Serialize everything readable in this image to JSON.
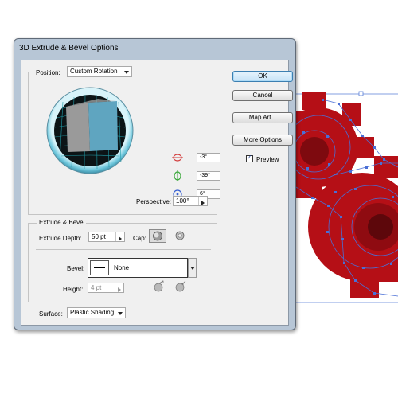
{
  "dialog": {
    "title": "3D Extrude & Bevel Options",
    "position": {
      "label": "Position:",
      "value": "Custom Rotation"
    },
    "rotation": {
      "x": "-3°",
      "y": "-39°",
      "z": "6°"
    },
    "perspective": {
      "label": "Perspective:",
      "value": "100°"
    },
    "extrude_bevel": {
      "section_title": "Extrude & Bevel",
      "depth_label": "Extrude Depth:",
      "depth_value": "50 pt",
      "cap_label": "Cap:",
      "bevel_label": "Bevel:",
      "bevel_value": "None",
      "height_label": "Height:",
      "height_value": "4 pt"
    },
    "surface": {
      "label": "Surface:",
      "value": "Plastic Shading"
    },
    "buttons": {
      "ok": "OK",
      "cancel": "Cancel",
      "map_art": "Map Art...",
      "more_options": "More Options"
    },
    "preview": {
      "label": "Preview",
      "checked": true
    }
  },
  "colors": {
    "gear": "#b50f16",
    "path": "#4a6fd6",
    "dialog_frame": "#b7c6d6",
    "default_button": "#c6e3f7"
  }
}
